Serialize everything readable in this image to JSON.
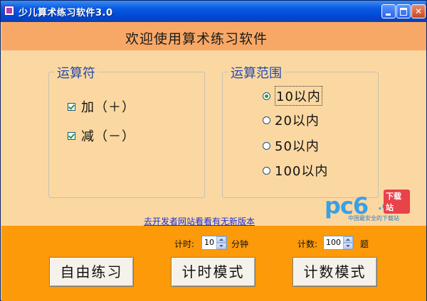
{
  "window": {
    "title": "少儿算术练习软件3.0",
    "controls": [
      "minimize-icon",
      "maximize-icon",
      "close-icon"
    ]
  },
  "banner": {
    "title": "欢迎使用算术练习软件"
  },
  "operators": {
    "legend": "运算符",
    "items": [
      {
        "label": "加（＋）",
        "checked": true
      },
      {
        "label": "减（－）",
        "checked": true
      }
    ]
  },
  "range": {
    "legend": "运算范围",
    "items": [
      {
        "label": "10以内",
        "selected": true
      },
      {
        "label": "20以内",
        "selected": false
      },
      {
        "label": "50以内",
        "selected": false
      },
      {
        "label": "100以内",
        "selected": false
      }
    ]
  },
  "watermark": {
    "brand": "pc6",
    "domain": ".com",
    "badge": "下载站",
    "tagline": "中国最安全的下载站"
  },
  "link": {
    "text": "去开发者网站看看有无新版本"
  },
  "timer": {
    "label": "计时:",
    "value": "10",
    "unit": "分钟"
  },
  "counter": {
    "label": "计数:",
    "value": "100",
    "unit": "题"
  },
  "buttons": {
    "free": "自由练习",
    "timed": "计时模式",
    "counted": "计数模式"
  },
  "colors": {
    "titlebar": "#0a5ce2",
    "panel": "#fbd8a2",
    "banner": "#f8a866",
    "footer": "#fd9a0a",
    "legend": "#2448a8",
    "link": "#1b2fd8"
  }
}
